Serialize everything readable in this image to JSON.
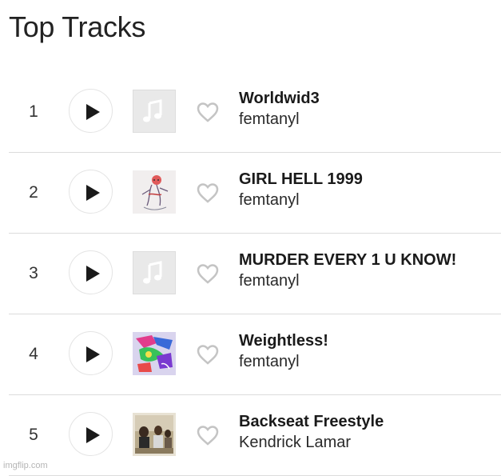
{
  "page": {
    "title": "Top Tracks"
  },
  "tracks": [
    {
      "rank": "1",
      "title": "Worldwid3",
      "artist": "femtanyl",
      "cover": "placeholder"
    },
    {
      "rank": "2",
      "title": "GIRL HELL 1999",
      "artist": "femtanyl",
      "cover": "art-sketch"
    },
    {
      "rank": "3",
      "title": "MURDER EVERY 1 U KNOW!",
      "artist": "femtanyl",
      "cover": "placeholder"
    },
    {
      "rank": "4",
      "title": "Weightless!",
      "artist": "femtanyl",
      "cover": "art-colorful"
    },
    {
      "rank": "5",
      "title": "Backseat Freestyle",
      "artist": "Kendrick Lamar",
      "cover": "art-photo"
    }
  ],
  "icons": {
    "play": "play-icon",
    "heart": "heart-outline-icon",
    "placeholder_cover": "music-note-icon"
  },
  "colors": {
    "text": "#222222",
    "divider": "#dcdcdc",
    "icon_gray": "#c4c4c4",
    "placeholder_bg": "#e9e9e9"
  },
  "watermark": "imgflip.com"
}
